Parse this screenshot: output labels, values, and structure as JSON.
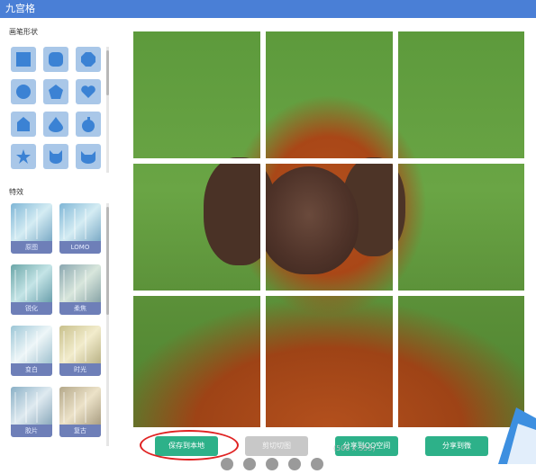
{
  "window": {
    "title": "九宫格",
    "accent": "#4a7fd6"
  },
  "sidebar": {
    "shape_section_label": "画笔形状",
    "effect_section_label": "特效",
    "shapes": [
      {
        "icon": "square-icon"
      },
      {
        "icon": "rounded-square-icon"
      },
      {
        "icon": "octagon-icon"
      },
      {
        "icon": "circle-icon"
      },
      {
        "icon": "pentagon-icon"
      },
      {
        "icon": "heart-icon"
      },
      {
        "icon": "house-icon"
      },
      {
        "icon": "drop-icon"
      },
      {
        "icon": "apple-icon"
      },
      {
        "icon": "star-icon"
      },
      {
        "icon": "cat-face-icon"
      },
      {
        "icon": "cat-head-icon"
      }
    ],
    "effects": [
      {
        "label": "原图"
      },
      {
        "label": "LOMO"
      },
      {
        "label": "锐化"
      },
      {
        "label": "柔焦"
      },
      {
        "label": "变白"
      },
      {
        "label": "时光"
      },
      {
        "label": "胶片"
      },
      {
        "label": "复古"
      }
    ]
  },
  "actions": {
    "save_local": "保存到本地",
    "save_local_color": "#2db189",
    "cut_label": "剪切切图",
    "share_qq": "分享到QQ空间",
    "share_other": "分享到微"
  },
  "watermark": "(500 x 355)",
  "highlight_color": "#e02222"
}
